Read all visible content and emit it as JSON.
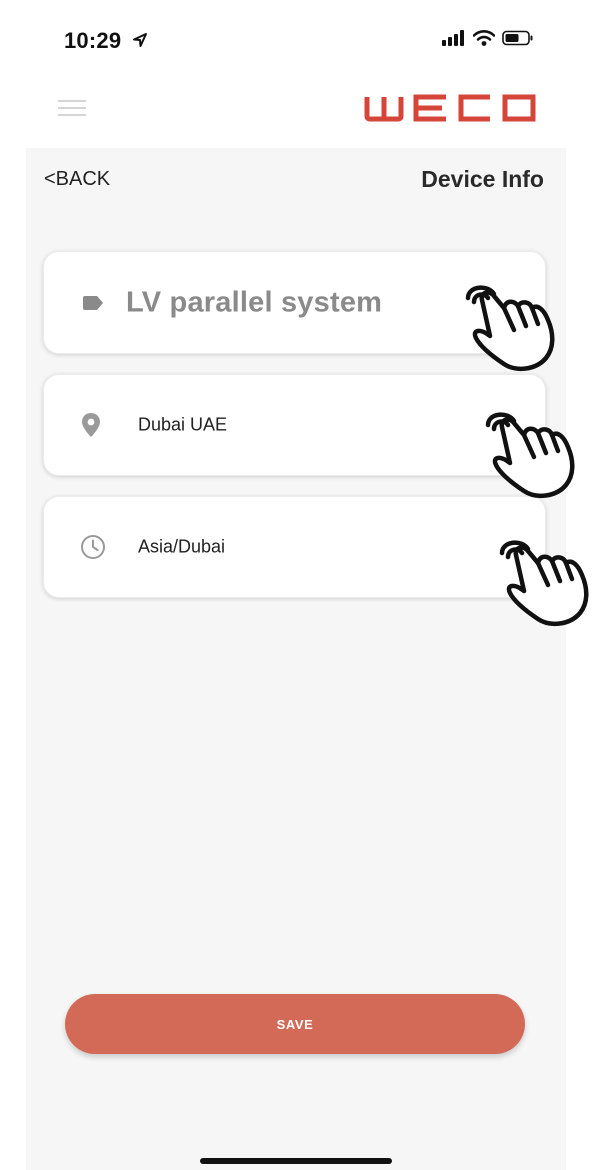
{
  "status_bar": {
    "time": "10:29",
    "location_icon": "location-arrow-icon",
    "icons": [
      "signal-icon",
      "wifi-icon",
      "battery-icon"
    ]
  },
  "header": {
    "menu_icon": "hamburger-menu-icon",
    "brand": "WECO",
    "brand_color": "#d6453a"
  },
  "nav": {
    "back_label": "<BACK",
    "title": "Device Info"
  },
  "fields": [
    {
      "icon": "tag-icon",
      "value": "LV parallel system"
    },
    {
      "icon": "location-pin-icon",
      "value": "Dubai UAE"
    },
    {
      "icon": "clock-icon",
      "value": "Asia/Dubai"
    }
  ],
  "save_label": "SAVE",
  "colors": {
    "accent": "#d36a58",
    "background": "#f6f6f6",
    "icon_gray": "#9a9a9a"
  }
}
